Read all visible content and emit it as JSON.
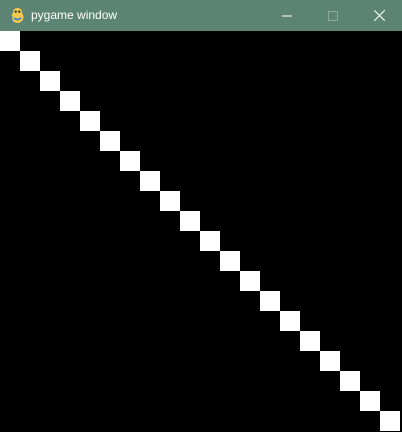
{
  "window": {
    "title": "pygame window",
    "titlebar_color": "#5c8474",
    "app_icon": "pygame-snake-icon",
    "controls": [
      "minimize-icon",
      "maximize-icon",
      "close-icon"
    ]
  },
  "canvas": {
    "background": "#000000",
    "square_color": "#ffffff",
    "square_count": 20
  }
}
